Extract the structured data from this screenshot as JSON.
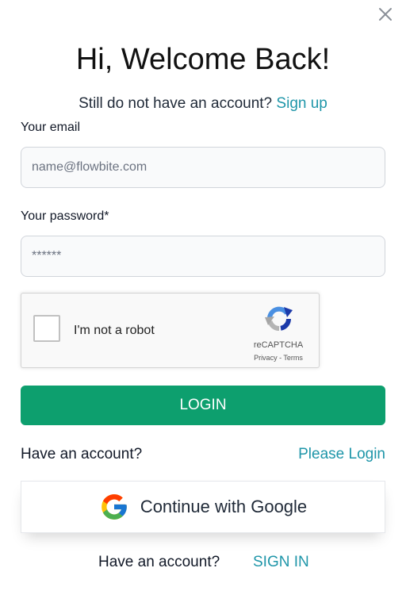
{
  "modal": {
    "title": "Hi, Welcome Back!",
    "subtitle_text": "Still do not have an account?",
    "signup_link": "Sign up"
  },
  "form": {
    "email_label": "Your email",
    "email_placeholder": "name@flowbite.com",
    "password_label": "Your password*",
    "password_placeholder": "******",
    "login_button": "LOGIN"
  },
  "captcha": {
    "label": "I'm not a robot",
    "brand": "reCAPTCHA",
    "privacy": "Privacy",
    "separator": " - ",
    "terms": "Terms",
    "checked": false
  },
  "links": {
    "have_account": "Have an account?",
    "please_login": "Please Login"
  },
  "google": {
    "label": "Continue with Google"
  },
  "footer": {
    "have_account": "Have an account?",
    "sign_in": "SIGN IN"
  },
  "icons": {
    "close": "close-icon",
    "google": "google-icon",
    "recaptcha": "recaptcha-logo-icon"
  },
  "colors": {
    "accent_teal": "#1f96a9",
    "login_green": "#0d9f6e"
  }
}
